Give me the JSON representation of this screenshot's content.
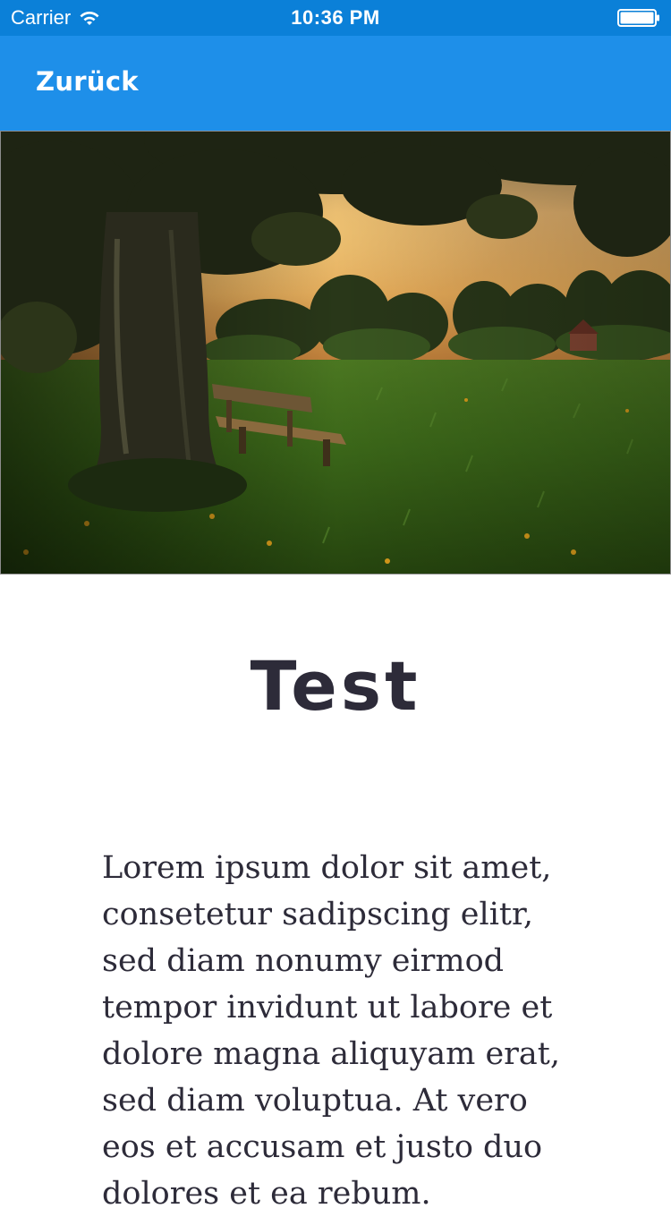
{
  "status_bar": {
    "carrier": "Carrier",
    "time": "10:36 PM"
  },
  "nav_bar": {
    "back_label": "Zurück"
  },
  "content": {
    "title": "Test",
    "body": "Lorem ipsum dolor sit amet, consetetur sadipscing elitr, sed diam nonumy eirmod tempor invidunt ut labore et dolore magna aliquyam erat, sed diam voluptua. At vero eos et accusam et justo duo dolores et ea rebum."
  },
  "colors": {
    "status_bar": "#0b80d8",
    "nav_bar": "#1e8fe9",
    "text": "#2d2b39"
  }
}
